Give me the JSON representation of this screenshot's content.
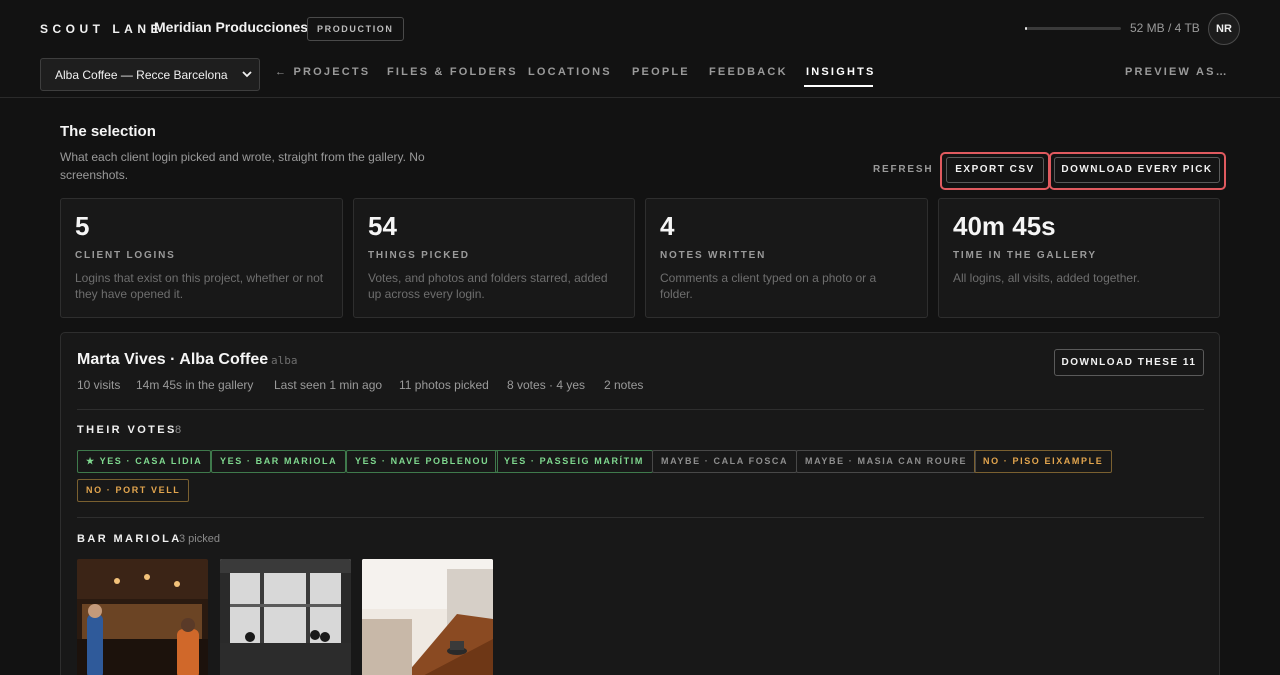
{
  "header": {
    "brand": "SCOUT LANE",
    "org_name": "Meridian Producciones",
    "badge": "PRODUCTION",
    "storage": {
      "text": "52 MB / 4 TB",
      "used_fraction": 0.013
    },
    "avatar_initials": "NR",
    "project_select": "Alba Coffee — Recce Barcelona",
    "nav": {
      "projects": "← PROJECTS",
      "files": "FILES & FOLDERS",
      "locations": "LOCATIONS",
      "people": "PEOPLE",
      "feedback": "FEEDBACK",
      "insights": "INSIGHTS",
      "preview": "PREVIEW AS…"
    }
  },
  "section": {
    "title": "The selection",
    "subtitle": "What each client login picked and wrote, straight from the gallery. No screenshots.",
    "refresh": "REFRESH",
    "export_csv": "EXPORT CSV",
    "download_every_pick": "DOWNLOAD EVERY PICK"
  },
  "stats": [
    {
      "value": "5",
      "label": "CLIENT LOGINS",
      "desc": "Logins that exist on this project, whether or not they have opened it."
    },
    {
      "value": "54",
      "label": "THINGS PICKED",
      "desc": "Votes, and photos and folders starred, added up across every login."
    },
    {
      "value": "4",
      "label": "NOTES WRITTEN",
      "desc": "Comments a client typed on a photo or a folder."
    },
    {
      "value": "40m 45s",
      "label": "TIME IN THE GALLERY",
      "desc": "All logins, all visits, added together."
    }
  ],
  "login": {
    "name": "Marta Vives · Alba Coffee",
    "handle": "alba",
    "download_these": "DOWNLOAD THESE 11",
    "meta": {
      "visits": "10 visits",
      "time": "14m 45s in the gallery",
      "last_seen": "Last seen 1 min ago",
      "photos": "11 photos picked",
      "votes": "8 votes · 4 yes",
      "notes": "2 notes"
    },
    "votes_title": "THEIR VOTES",
    "votes_count": "8",
    "votes": [
      {
        "text": "★ YES · CASA LIDIA",
        "kind": "yes"
      },
      {
        "text": "YES · BAR MARIOLA",
        "kind": "yes"
      },
      {
        "text": "YES · NAVE POBLENOU",
        "kind": "yes"
      },
      {
        "text": "YES · PASSEIG MARÍTIM",
        "kind": "yes"
      },
      {
        "text": "MAYBE · CALA FOSCA",
        "kind": "maybe"
      },
      {
        "text": "MAYBE · MASIA CAN ROURE",
        "kind": "maybe"
      },
      {
        "text": "NO · PISO EIXAMPLE",
        "kind": "no"
      },
      {
        "text": "NO · PORT VELL",
        "kind": "no"
      }
    ],
    "group_title": "BAR MARIOLA",
    "group_count": "3 picked"
  }
}
